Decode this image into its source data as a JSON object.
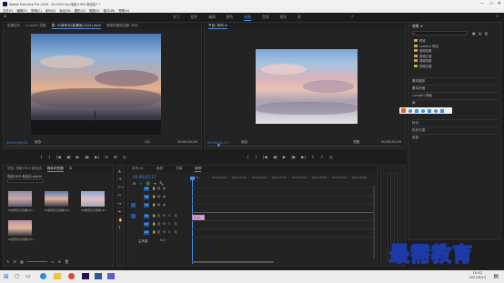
{
  "window": {
    "title": "Adobe Premiere Pro 2020 - D:\\1903 Syr\\电影\\1903 新自由* *",
    "menu": [
      "文件(F)",
      "编辑(E)",
      "剪辑(C)",
      "序列(S)",
      "标记(M)",
      "图形(G)",
      "视图(V)",
      "窗口(W)",
      "帮助(H)"
    ],
    "workspaces": [
      "学习",
      "组件",
      "编辑",
      "颜色",
      "效果",
      "音频",
      "图形",
      "库"
    ],
    "active_workspace": "效果"
  },
  "source_monitor": {
    "tabs": [
      "效果控件",
      "Lumetri 范围",
      "源: 01新风光(高清版)(2)[0].mp4",
      "音频剪辑混合器: 序列"
    ],
    "active_tab": "源: 01新风光(高清版)(2)[0].mp4",
    "timecode": "00;00;00;00",
    "fit": "适合",
    "ratio": "1/2",
    "duration": "00;00;01;00"
  },
  "program_monitor": {
    "title": "节目: 序列 ≡",
    "timecode": "00;00;01;17",
    "zoom": "适合",
    "ratio": "完整",
    "duration": "00;00;01;00"
  },
  "effects_panel": {
    "title": "效果 ≡",
    "items": [
      "预设",
      "Lumetri 预设",
      "音频效果",
      "音频过渡",
      "视频效果",
      "视频过渡"
    ],
    "sections": [
      "基本图形",
      "基本声音",
      "Lumetri 颜色",
      "库",
      "标记",
      "历史记录",
      "信息"
    ]
  },
  "project_panel": {
    "tabs": [
      "项目: 电影1903 新自由",
      "媒体浏览器",
      "库",
      "信息",
      "效果",
      "标记",
      "历史记录"
    ],
    "active_tab": "媒体浏览器",
    "path": "电影1903 新自由.prproj",
    "clips": [
      {
        "name": "01新风光(高清版)(2)...",
        "dur": "1:00"
      },
      {
        "name": "01新风光(高清版)(2)...",
        "dur": "1:00"
      },
      {
        "name": "01新风光(高清版)(2)...",
        "dur": "1:00"
      },
      {
        "name": "01新风光(高清版)(2)...",
        "dur": "1:00"
      }
    ]
  },
  "timeline": {
    "tabs": [
      "序列 01",
      "音频",
      "字幕",
      "序列"
    ],
    "active_tab": "序列",
    "timecode": "00;00;01;17",
    "ruler": [
      "00;00",
      "00;00;05;00",
      "00;00;10;00",
      "00;00;15;00",
      "00;00;20;00",
      "00;00;25;00",
      "00;00;30;00",
      "00;00;35;00",
      "00;00;40;00"
    ],
    "video_tracks": [
      "V3",
      "V2",
      "V1"
    ],
    "audio_tracks": [
      "A1",
      "A2",
      "A3"
    ],
    "master": "主声道",
    "master_value": "0.0",
    "clip_label": "fx 01"
  },
  "taskbar": {
    "time": "15:42",
    "date": "2021/6/13"
  },
  "watermark": "最需教育",
  "colors": {
    "accent": "#3f8ee8",
    "playhead": "#3f8ee8",
    "clip": "#d9a0d8",
    "background": "#1d1d1d"
  }
}
